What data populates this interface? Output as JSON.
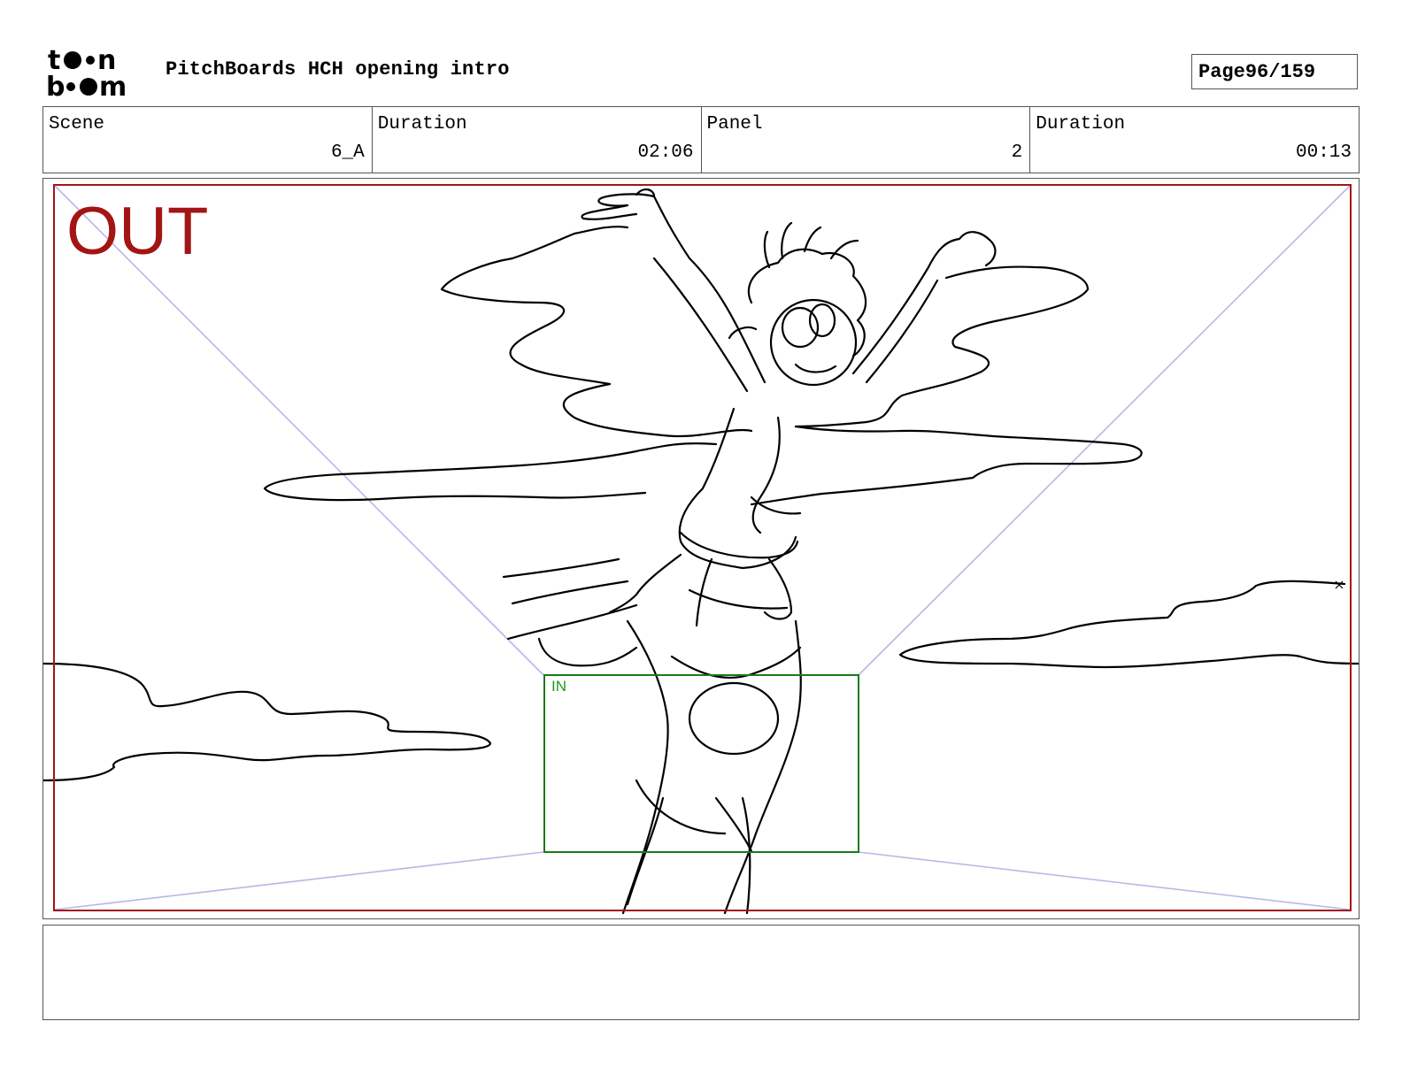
{
  "header": {
    "logo_text": "toonboom",
    "title": "PitchBoards HCH opening intro",
    "page_label": "Page",
    "page_value": "96/159"
  },
  "info": [
    {
      "label": "Scene",
      "value": "6_A"
    },
    {
      "label": "Duration",
      "value": "02:06"
    },
    {
      "label": "Panel",
      "value": "2"
    },
    {
      "label": "Duration",
      "value": "00:13"
    }
  ],
  "panel": {
    "out_label": "OUT",
    "in_label": "IN",
    "out_frame_color": "#a31515",
    "in_frame_color": "#1a7a1a",
    "perspective_line_color": "#b9b6e6"
  },
  "notes": {
    "text": ""
  }
}
